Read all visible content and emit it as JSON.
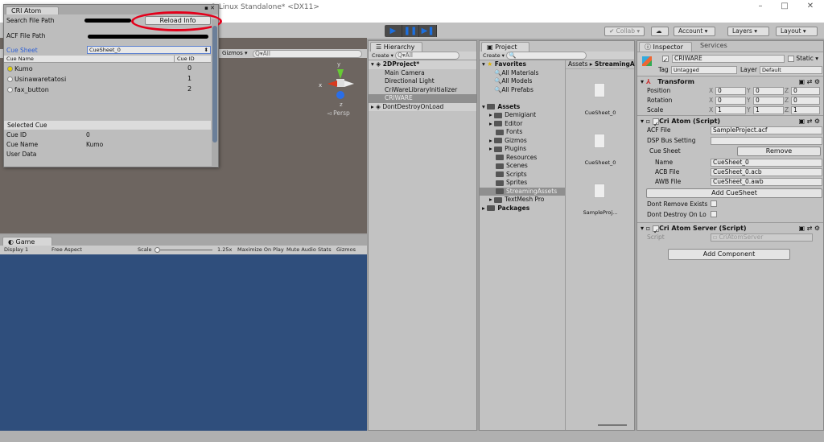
{
  "window": {
    "title": "& Linux Standalone* <DX11>"
  },
  "toolbar": {
    "collab": "Collab",
    "account": "Account",
    "layers": "Layers",
    "layout": "Layout"
  },
  "cri_window": {
    "tab": "CRI Atom",
    "search_file_path_label": "Search File Path",
    "reload_button": "Reload Info",
    "acf_file_path_label": "ACF File Path",
    "cue_sheet_label": "Cue Sheet",
    "cue_sheet_value": "CueSheet_0",
    "col_name": "Cue Name",
    "col_id": "Cue ID",
    "cues": [
      {
        "name": "Kumo",
        "id": "0",
        "selected": true
      },
      {
        "name": "Usinawaretatosi",
        "id": "1"
      },
      {
        "name": "fax_button",
        "id": "2"
      }
    ],
    "selected_cue_header": "Selected Cue",
    "cue_id_label": "Cue ID",
    "cue_id": "0",
    "cue_name_label": "Cue Name",
    "cue_name": "Kumo",
    "user_data_label": "User Data",
    "accent": "#e3001b"
  },
  "scene": {
    "gizmos": "Gizmos",
    "search": "Q▾All",
    "persp": "◅ Persp",
    "axis_y": "y",
    "axis_x": "x",
    "axis_z": "z"
  },
  "game": {
    "tab": "Game",
    "display": "Display 1",
    "aspect": "Free Aspect",
    "scale_label": "Scale",
    "scale_value": "1.25x",
    "maximize": "Maximize On Play",
    "mute": "Mute Audio",
    "stats": "Stats",
    "gizmos": "Gizmos",
    "bg": "#2f4e7c"
  },
  "hierarchy": {
    "tab": "Hierarchy",
    "create": "Create",
    "search": "Q▾All",
    "scene": "2DProject*",
    "items": [
      "Main Camera",
      "Directional Light",
      "CriWareLibraryInitializer",
      "CRIWARE"
    ],
    "ddol": "DontDestroyOnLoad"
  },
  "project": {
    "tab": "Project",
    "create": "Create",
    "favorites": "Favorites",
    "fav_items": [
      "All Materials",
      "All Models",
      "All Prefabs"
    ],
    "assets": "Assets",
    "folders": [
      "Demigiant",
      "Editor",
      "Fonts",
      "Gizmos",
      "Plugins",
      "Resources",
      "Scenes",
      "Scripts",
      "Sprites",
      "StreamingAssets",
      "TextMesh Pro"
    ],
    "packages": "Packages",
    "breadcrumb_root": "Assets",
    "breadcrumb_current": "StreamingA",
    "files": [
      "CueSheet_0",
      "CueSheet_0",
      "SampleProj..."
    ]
  },
  "inspector": {
    "tab": "Inspector",
    "tab2": "Services",
    "object_name": "CRIWARE",
    "static": "Static",
    "tag_label": "Tag",
    "tag": "Untagged",
    "layer_label": "Layer",
    "layer": "Default",
    "transform": {
      "title": "Transform",
      "rows": [
        {
          "label": "Position",
          "x": "0",
          "y": "0",
          "z": "0"
        },
        {
          "label": "Rotation",
          "x": "0",
          "y": "0",
          "z": "0"
        },
        {
          "label": "Scale",
          "x": "1",
          "y": "1",
          "z": "1"
        }
      ]
    },
    "cri_atom": {
      "title": "Cri Atom (Script)",
      "acf_label": "ACF File",
      "acf": "SampleProject.acf",
      "dsp_label": "DSP Bus Setting",
      "dsp": "",
      "cue_sheet_label": "Cue Sheet",
      "remove": "Remove",
      "name_label": "Name",
      "name": "CueSheet_0",
      "acb_label": "ACB File",
      "acb": "CueSheet_0.acb",
      "awb_label": "AWB File",
      "awb": "CueSheet_0.awb",
      "add_cuesheet": "Add CueSheet",
      "dont_remove": "Dont Remove Exists",
      "dont_destroy": "Dont Destroy On Lo"
    },
    "server": {
      "title": "Cri Atom Server (Script)",
      "script_label": "Script",
      "script": "CriAtomServer"
    },
    "add_component": "Add Component"
  }
}
